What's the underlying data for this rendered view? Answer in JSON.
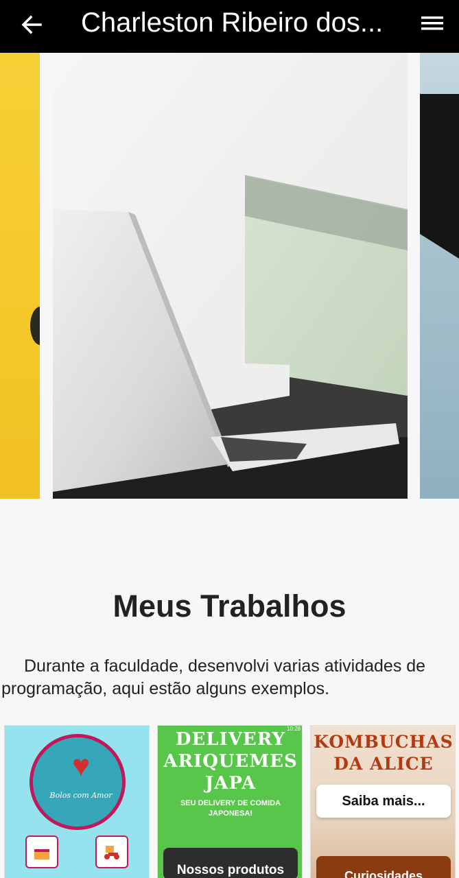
{
  "appbar": {
    "back_icon": "arrow-left-icon",
    "title": "Charleston Ribeiro dos...",
    "menu_icon": "hamburger-menu-icon"
  },
  "carousel": {
    "slides": [
      "yellow background with object",
      "laptop on desk",
      "blue fabric background"
    ]
  },
  "section": {
    "title": "Meus Trabalhos",
    "description": "Durante a faculdade, desenvolvi varias atividades de programação, aqui estão alguns exemplos."
  },
  "cards": [
    {
      "logo_text": "Bolos com Amor"
    },
    {
      "status_time": "10:28",
      "title": "DELIVERY ARIQUEMES JAPA",
      "subtitle": "SEU DELIVERY DE COMIDA JAPONESA!",
      "button": "Nossos produtos"
    },
    {
      "title": "KOMBUCHAS DA ALICE",
      "button": "Saiba mais...",
      "button2": "Curiosidades"
    }
  ],
  "colors": {
    "appbar": "#000000",
    "background": "#f7f7f7",
    "card1": "#94e3ee",
    "card2": "#57c64b",
    "kombucha_title": "#b23a12"
  }
}
